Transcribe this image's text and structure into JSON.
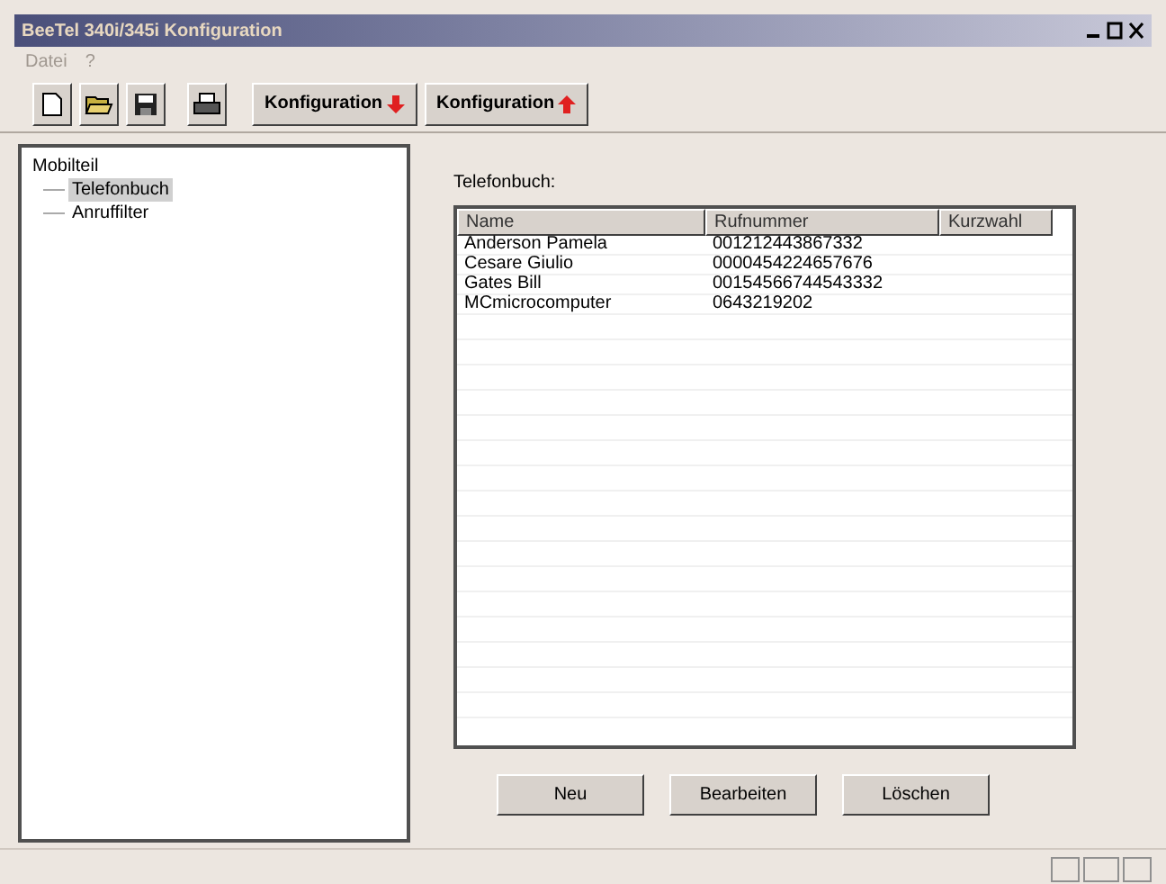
{
  "window": {
    "title": "BeeTel 340i/345i Konfiguration"
  },
  "menu": [
    {
      "label": "Datei"
    },
    {
      "label": "?"
    }
  ],
  "toolbar": {
    "icon_buttons": [
      {
        "kind": "new"
      },
      {
        "kind": "open"
      },
      {
        "kind": "save"
      },
      {
        "kind": "print"
      }
    ],
    "text_buttons": [
      {
        "label": "Konfiguration",
        "kind": "down"
      },
      {
        "label": "Konfiguration",
        "kind": "up"
      }
    ]
  },
  "tree": [
    {
      "label": "Mobilteil",
      "selected": false,
      "children": [
        {
          "label": "Telefonbuch",
          "selected": true
        },
        {
          "label": "Anruffilter",
          "selected": false
        }
      ]
    }
  ],
  "phonebook": {
    "label": "Telefonbuch:",
    "columns": [
      "Name",
      "Rufnummer",
      "Kurzwahl"
    ],
    "rows": [
      [
        "Anderson Pamela",
        "001212443867332"
      ],
      [
        "Cesare Giulio",
        "0000454224657676"
      ],
      [
        "Gates Bill",
        "00154566744543332"
      ],
      [
        "MCmicrocomputer",
        "0643219202"
      ]
    ]
  },
  "buttons": [
    "Neu",
    "Bearbeiten",
    "Löschen"
  ]
}
